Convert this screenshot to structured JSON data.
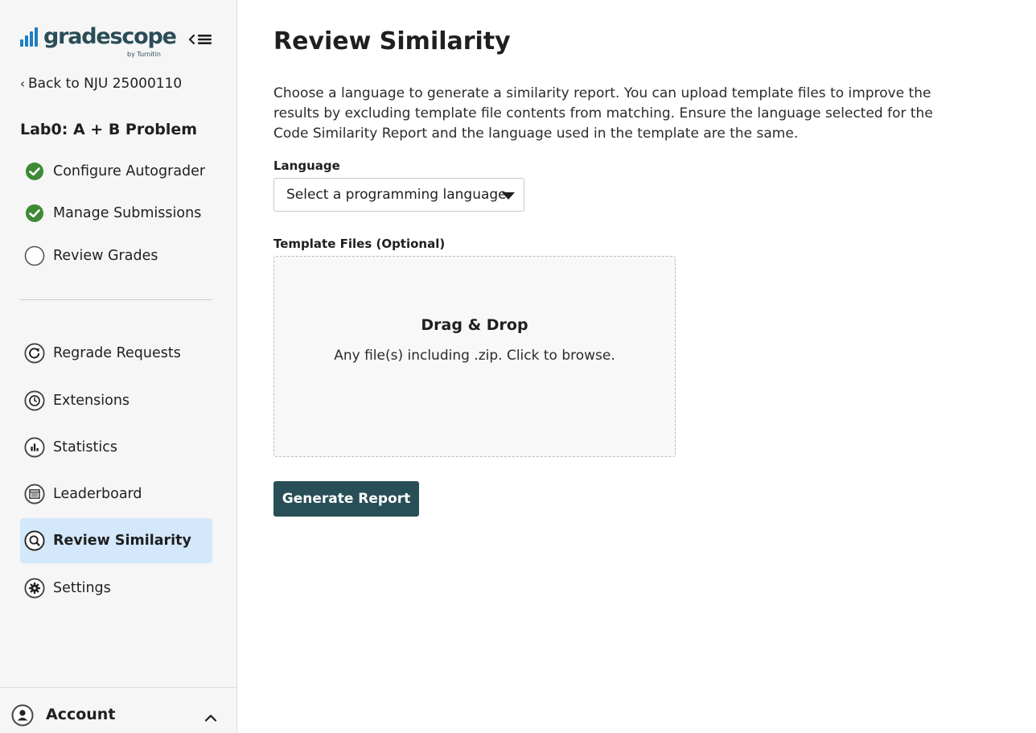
{
  "sidebar": {
    "logo_text": "gradescope",
    "logo_byline": "by Turnitin",
    "back_link": "Back to NJU 25000110",
    "assignment_title": "Lab0: A + B Problem",
    "workflow": [
      {
        "label": "Configure Autograder",
        "status": "complete",
        "icon": "check-circle-icon"
      },
      {
        "label": "Manage Submissions",
        "status": "complete",
        "icon": "check-circle-icon"
      },
      {
        "label": "Review Grades",
        "status": "incomplete",
        "icon": "empty-circle-icon"
      }
    ],
    "tools": [
      {
        "label": "Regrade Requests",
        "icon": "regrade-icon"
      },
      {
        "label": "Extensions",
        "icon": "clock-icon"
      },
      {
        "label": "Statistics",
        "icon": "bar-chart-icon"
      },
      {
        "label": "Leaderboard",
        "icon": "leaderboard-icon"
      },
      {
        "label": "Review Similarity",
        "icon": "search-icon",
        "active": true
      },
      {
        "label": "Settings",
        "icon": "gear-icon"
      }
    ],
    "account_label": "Account"
  },
  "main": {
    "title": "Review Similarity",
    "description": "Choose a language to generate a similarity report. You can upload template files to improve the results by excluding template file contents from matching. Ensure the language selected for the Code Similarity Report and the language used in the template are the same.",
    "language_label": "Language",
    "language_value": "Select a programming language",
    "template_label": "Template Files (Optional)",
    "dropzone_title": "Drag & Drop",
    "dropzone_subtitle": "Any file(s) including .zip. Click to browse.",
    "generate_button": "Generate Report"
  },
  "colors": {
    "brand_blue": "#1d7ec4",
    "brand_dark": "#2a4d57",
    "check_green": "#3e8a35",
    "active_bg": "#d4e8fb",
    "button_bg": "#284f57"
  }
}
